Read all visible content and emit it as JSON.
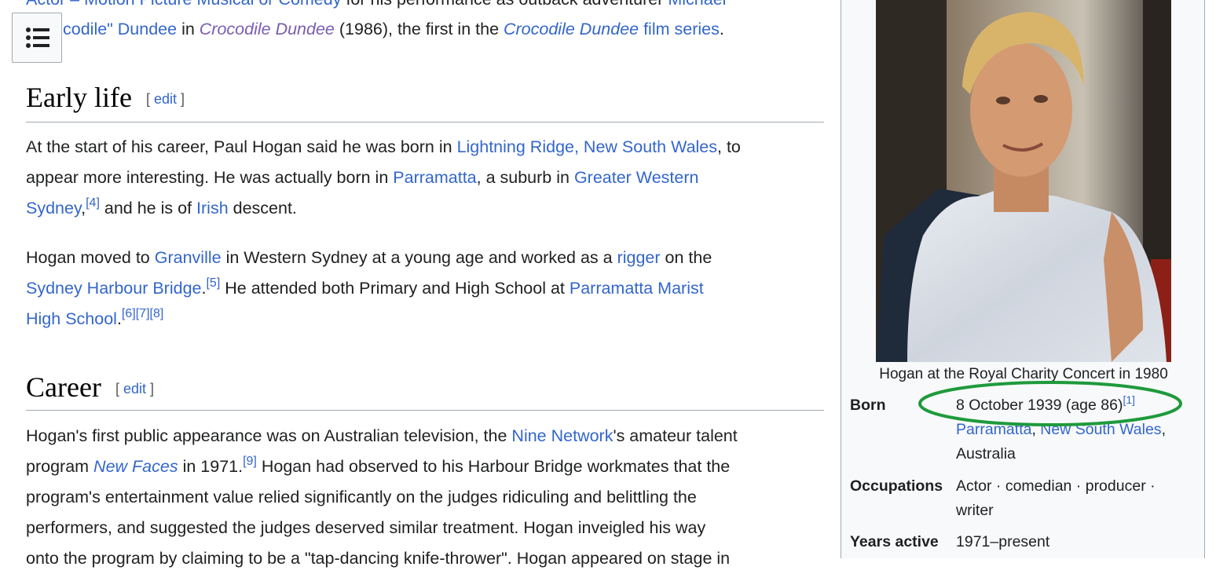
{
  "intro": {
    "line1_a": "Actor – Motion Picture Musical or Comedy",
    "line1_b": " for his performance as outback adventurer ",
    "line1_c": "Michael",
    "line2_a": "codile\" Dundee",
    "line2_b": " in ",
    "line2_c": "Crocodile Dundee",
    "line2_d": " (1986), the first in the ",
    "line2_e": "Crocodile Dundee",
    "line2_f": " film series",
    "line2_g": "."
  },
  "early_life": {
    "heading": "Early life",
    "edit_open": "[",
    "edit": "edit",
    "edit_close": "]",
    "p1": {
      "t1": "At the start of his career, Paul Hogan said he was born in ",
      "l1": "Lightning Ridge, New South Wales",
      "t2": ", to",
      "t3": "appear more interesting. He was actually born in ",
      "l2": "Parramatta",
      "t4": ", a suburb in ",
      "l3": "Greater Western",
      "l4": "Sydney",
      "t5": ",",
      "ref1": "[4]",
      "t6": " and he is of ",
      "l5": "Irish",
      "t7": " descent."
    },
    "p2": {
      "t1": "Hogan moved to ",
      "l1": "Granville",
      "t2": " in Western Sydney at a young age and worked as a ",
      "l2": "rigger",
      "t3": " on the",
      "l3": "Sydney Harbour Bridge",
      "t4": ".",
      "ref1": "[5]",
      "t5": " He attended both Primary and High School at ",
      "l4": "Parramatta Marist",
      "l5": "High School",
      "t6": ".",
      "ref2": "[6]",
      "ref3": "[7]",
      "ref4": "[8]"
    }
  },
  "career": {
    "heading": "Career",
    "edit_open": "[",
    "edit": "edit",
    "edit_close": "]",
    "p1": {
      "t1": "Hogan's first public appearance was on Australian television, the ",
      "l1": "Nine Network",
      "t2": "'s amateur talent",
      "t3": "program ",
      "l2": "New Faces",
      "t4": " in 1971.",
      "ref1": "[9]",
      "t5": " Hogan had observed to his Harbour Bridge workmates that the",
      "t6": "program's entertainment value relied significantly on the judges ridiculing and belittling the",
      "t7": "performers, and suggested the judges deserved similar treatment. Hogan inveigled his way",
      "t8": "onto the program by claiming to be a \"tap-dancing knife-thrower\". Hogan appeared on stage in"
    }
  },
  "infobox": {
    "caption": "Hogan at the Royal Charity Concert in 1980",
    "born_label": "Born",
    "born_date": "8 October 1939 (age 86)",
    "born_ref": "[1]",
    "born_place1": "Parramatta",
    "born_sep": ", ",
    "born_place2": "New South Wales",
    "born_comma": ",",
    "born_country": "Australia",
    "occ_label": "Occupations",
    "occ_line1": "Actor · comedian · producer ·",
    "occ_line2": "writer",
    "years_label": "Years active",
    "years_value": "1971–present"
  },
  "colors": {
    "link": "#3366cc",
    "visited_link": "#795cb2",
    "annotation": "#1e9a3c"
  },
  "icons": {
    "toc": "list-icon"
  }
}
